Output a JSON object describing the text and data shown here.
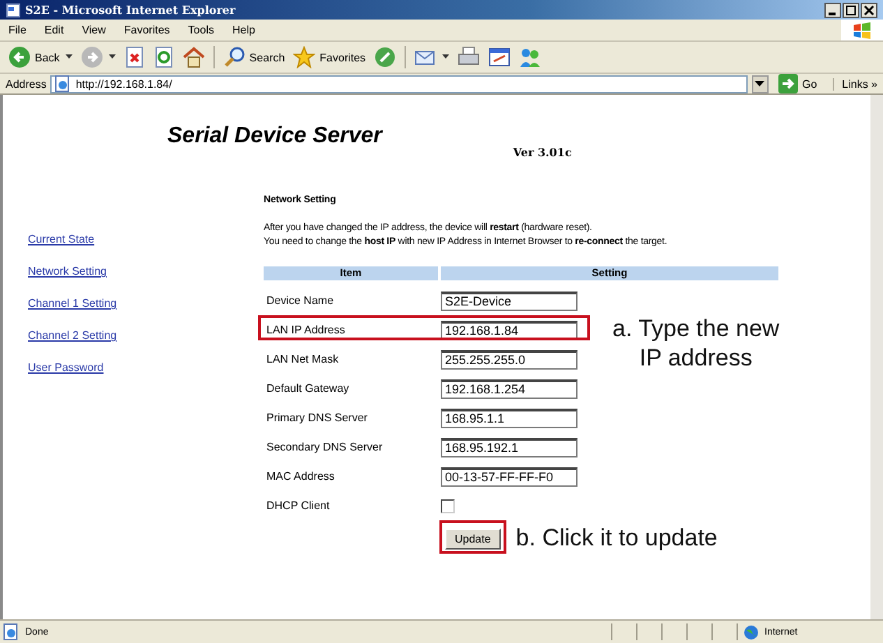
{
  "window": {
    "title": "S2E - Microsoft Internet Explorer"
  },
  "menu": [
    "File",
    "Edit",
    "View",
    "Favorites",
    "Tools",
    "Help"
  ],
  "toolbar": [
    {
      "kind": "back",
      "label": "Back"
    },
    {
      "kind": "forward"
    },
    {
      "kind": "stop"
    },
    {
      "kind": "refresh"
    },
    {
      "kind": "home"
    },
    {
      "kind": "search",
      "label": "Search"
    },
    {
      "kind": "favorites",
      "label": "Favorites"
    },
    {
      "kind": "media"
    },
    {
      "kind": "mail"
    },
    {
      "kind": "print"
    },
    {
      "kind": "edit"
    },
    {
      "kind": "messenger"
    }
  ],
  "address_bar": {
    "label": "Address",
    "value": "http://192.168.1.84/",
    "go": "Go",
    "links": "Links",
    "more": "»"
  },
  "page": {
    "heading": "Serial Device Server",
    "version": "Ver 3.01c",
    "nav": [
      {
        "label": "Current State"
      },
      {
        "label": "Network Setting"
      },
      {
        "label": "Channel 1 Setting"
      },
      {
        "label": "Channel 2 Setting"
      },
      {
        "label": "User Password"
      }
    ],
    "section_title": "Network Setting",
    "notes": [
      "After you have changed the IP address, the device will **restart** (hardware reset).",
      "You need to change the **host IP** with new IP Address in Internet Browser to **re-connect** the target."
    ],
    "table": {
      "columns": [
        "Item",
        "Setting"
      ],
      "rows": [
        {
          "label": "Device Name",
          "kind": "text",
          "value": "S2E-Device"
        },
        {
          "label": "LAN IP Address",
          "kind": "text",
          "value": "192.168.1.84",
          "highlighted": true
        },
        {
          "label": "LAN Net Mask",
          "kind": "text",
          "value": "255.255.255.0"
        },
        {
          "label": "Default Gateway",
          "kind": "text",
          "value": "192.168.1.254"
        },
        {
          "label": "Primary DNS Server",
          "kind": "text",
          "value": "168.95.1.1"
        },
        {
          "label": "Secondary DNS Server",
          "kind": "text",
          "value": "168.95.192.1"
        },
        {
          "label": "MAC Address",
          "kind": "text",
          "value": "00-13-57-FF-FF-F0"
        },
        {
          "label": "DHCP Client",
          "kind": "checkbox",
          "checked": false
        }
      ]
    },
    "button": {
      "label": "Update",
      "highlighted": true
    }
  },
  "annotations": [
    "a. Type the new\nIP address",
    "b. Click it to update"
  ],
  "status_bar": {
    "text": "Done",
    "zone": "Internet"
  }
}
